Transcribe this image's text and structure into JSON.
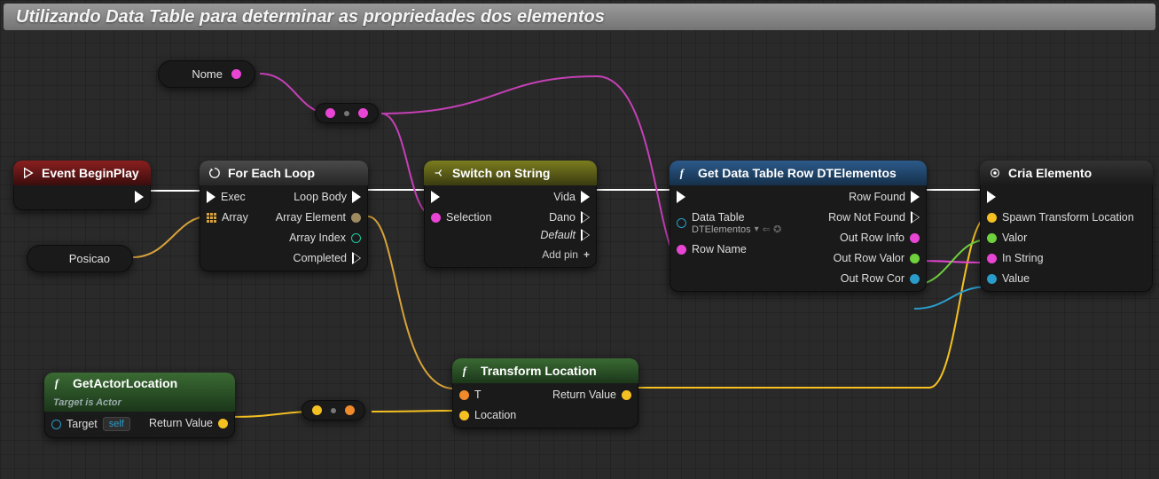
{
  "title": "Utilizando Data Table para determinar as propriedades dos elementos",
  "vars": {
    "nome": "Nome",
    "posicao": "Posicao"
  },
  "nodes": {
    "beginplay": {
      "title": "Event BeginPlay"
    },
    "foreach": {
      "title": "For Each Loop",
      "pins": {
        "exec": "Exec",
        "array": "Array",
        "loopbody": "Loop Body",
        "element": "Array Element",
        "index": "Array Index",
        "completed": "Completed"
      }
    },
    "switch": {
      "title": "Switch on String",
      "pins": {
        "selection": "Selection",
        "vida": "Vida",
        "dano": "Dano",
        "default": "Default",
        "addpin": "Add pin"
      }
    },
    "gettable": {
      "title": "Get Data Table Row DTElementos",
      "pins": {
        "datatable": "Data Table",
        "datatable_value": "DTElementos",
        "rowname": "Row Name",
        "rowfound": "Row Found",
        "notfound": "Row Not Found",
        "outinfo": "Out Row Info",
        "outvalor": "Out Row Valor",
        "outcor": "Out Row Cor"
      }
    },
    "cria": {
      "title": "Cria Elemento",
      "pins": {
        "spawn": "Spawn Transform Location",
        "valor": "Valor",
        "instring": "In String",
        "value": "Value"
      }
    },
    "getactor": {
      "title": "GetActorLocation",
      "sub": "Target is Actor",
      "pins": {
        "target": "Target",
        "targetval": "self",
        "retval": "Return Value"
      }
    },
    "transform": {
      "title": "Transform Location",
      "pins": {
        "t": "T",
        "location": "Location",
        "retval": "Return Value"
      }
    }
  }
}
